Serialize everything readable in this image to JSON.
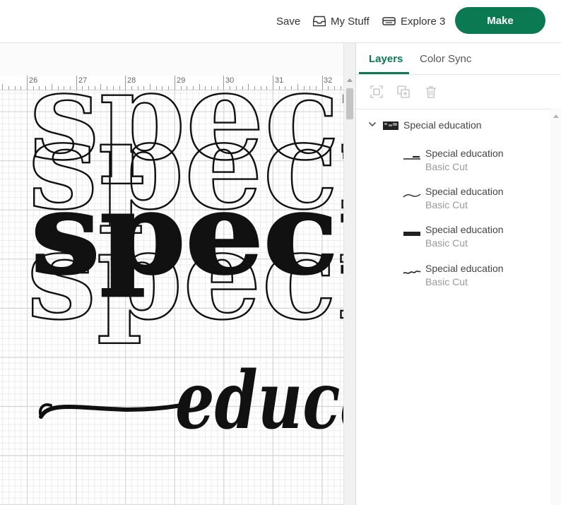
{
  "colors": {
    "accent": "#0b7a52",
    "design_ink": "#111111"
  },
  "topbar": {
    "save_label": "Save",
    "mystuff_label": "My Stuff",
    "mystuff_icon": "inbox-icon",
    "machine_label": "Explore 3",
    "machine_icon": "cutting-machine-icon",
    "make_label": "Make"
  },
  "ruler": {
    "numbers": [
      "26",
      "27",
      "28",
      "29",
      "30",
      "31",
      "32"
    ]
  },
  "design": {
    "outline_word": "speci",
    "bold_word": "speci",
    "script_word": "educa"
  },
  "panel": {
    "tabs": [
      {
        "label": "Layers",
        "active": true
      },
      {
        "label": "Color Sync",
        "active": false
      }
    ],
    "tools": [
      "group-icon",
      "duplicate-icon",
      "delete-icon"
    ],
    "group": {
      "label": "Special education",
      "expanded": true
    },
    "layers": [
      {
        "name": "Special education",
        "operation": "Basic Cut"
      },
      {
        "name": "Special education",
        "operation": "Basic Cut"
      },
      {
        "name": "Special education",
        "operation": "Basic Cut"
      },
      {
        "name": "Special education",
        "operation": "Basic Cut"
      }
    ]
  }
}
